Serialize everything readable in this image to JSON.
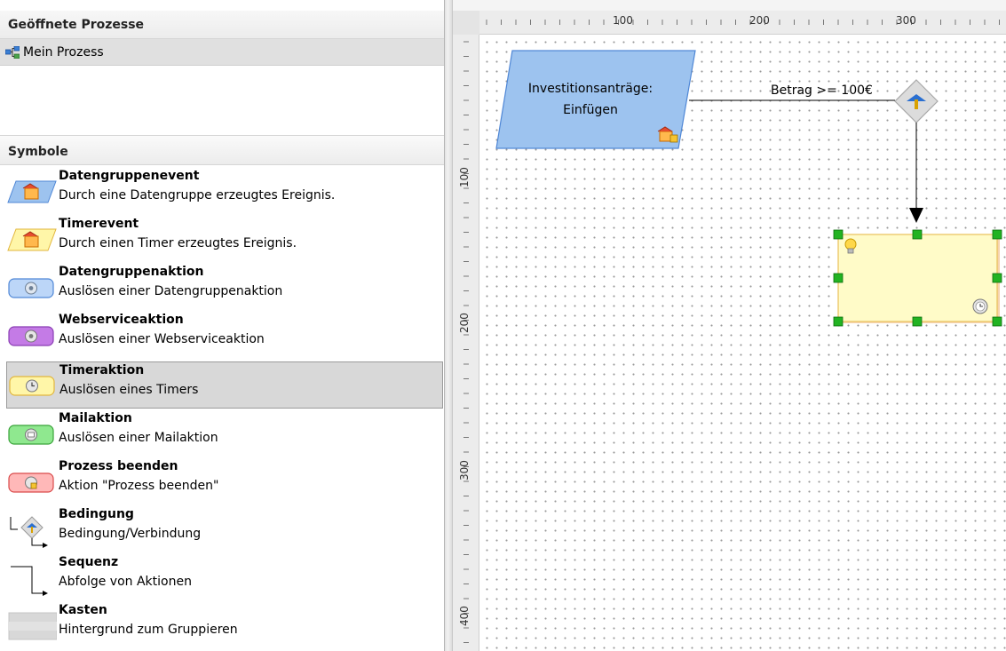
{
  "open_processes": {
    "header": "Geöffnete Prozesse",
    "items": [
      {
        "label": "Mein Prozess",
        "icon": "process-tree-icon"
      }
    ]
  },
  "symbols": {
    "header": "Symbole",
    "items": [
      {
        "title": "Datengruppenevent",
        "desc": "Durch eine Datengruppe erzeugtes Ereignis.",
        "icon": "datagroup-event-icon"
      },
      {
        "title": "Timerevent",
        "desc": "Durch einen Timer erzeugtes Ereignis.",
        "icon": "timer-event-icon"
      },
      {
        "title": "Datengruppenaktion",
        "desc": "Auslösen einer Datengruppenaktion",
        "icon": "datagroup-action-icon"
      },
      {
        "title": "Webserviceaktion",
        "desc": "Auslösen einer Webserviceaktion",
        "icon": "webservice-action-icon"
      },
      {
        "title": "Timeraktion",
        "desc": "Auslösen eines Timers",
        "icon": "timer-action-icon",
        "selected": true
      },
      {
        "title": "Mailaktion",
        "desc": "Auslösen einer Mailaktion",
        "icon": "mail-action-icon"
      },
      {
        "title": "Prozess beenden",
        "desc": "Aktion \"Prozess beenden\"",
        "icon": "end-process-icon"
      },
      {
        "title": "Bedingung",
        "desc": "Bedingung/Verbindung",
        "icon": "condition-icon"
      },
      {
        "title": "Sequenz",
        "desc": "Abfolge von Aktionen",
        "icon": "sequence-icon"
      },
      {
        "title": "Kasten",
        "desc": "Hintergrund zum Gruppieren",
        "icon": "box-icon"
      }
    ]
  },
  "canvas": {
    "ruler_top_labels": [
      "100",
      "200",
      "300"
    ],
    "ruler_left_labels": [
      "100",
      "200",
      "300",
      "400"
    ],
    "event_node": {
      "line1": "Investitionsanträge:",
      "line2": "Einfügen"
    },
    "condition_label": "Betrag >= 100€"
  },
  "colors": {
    "event_fill": "#9dc3ef",
    "event_stroke": "#4f87d6",
    "action_fill": "#fffbc8",
    "action_stroke": "#e8c25a",
    "handle": "#22b322",
    "selection_bg": "#d8d8d8"
  }
}
